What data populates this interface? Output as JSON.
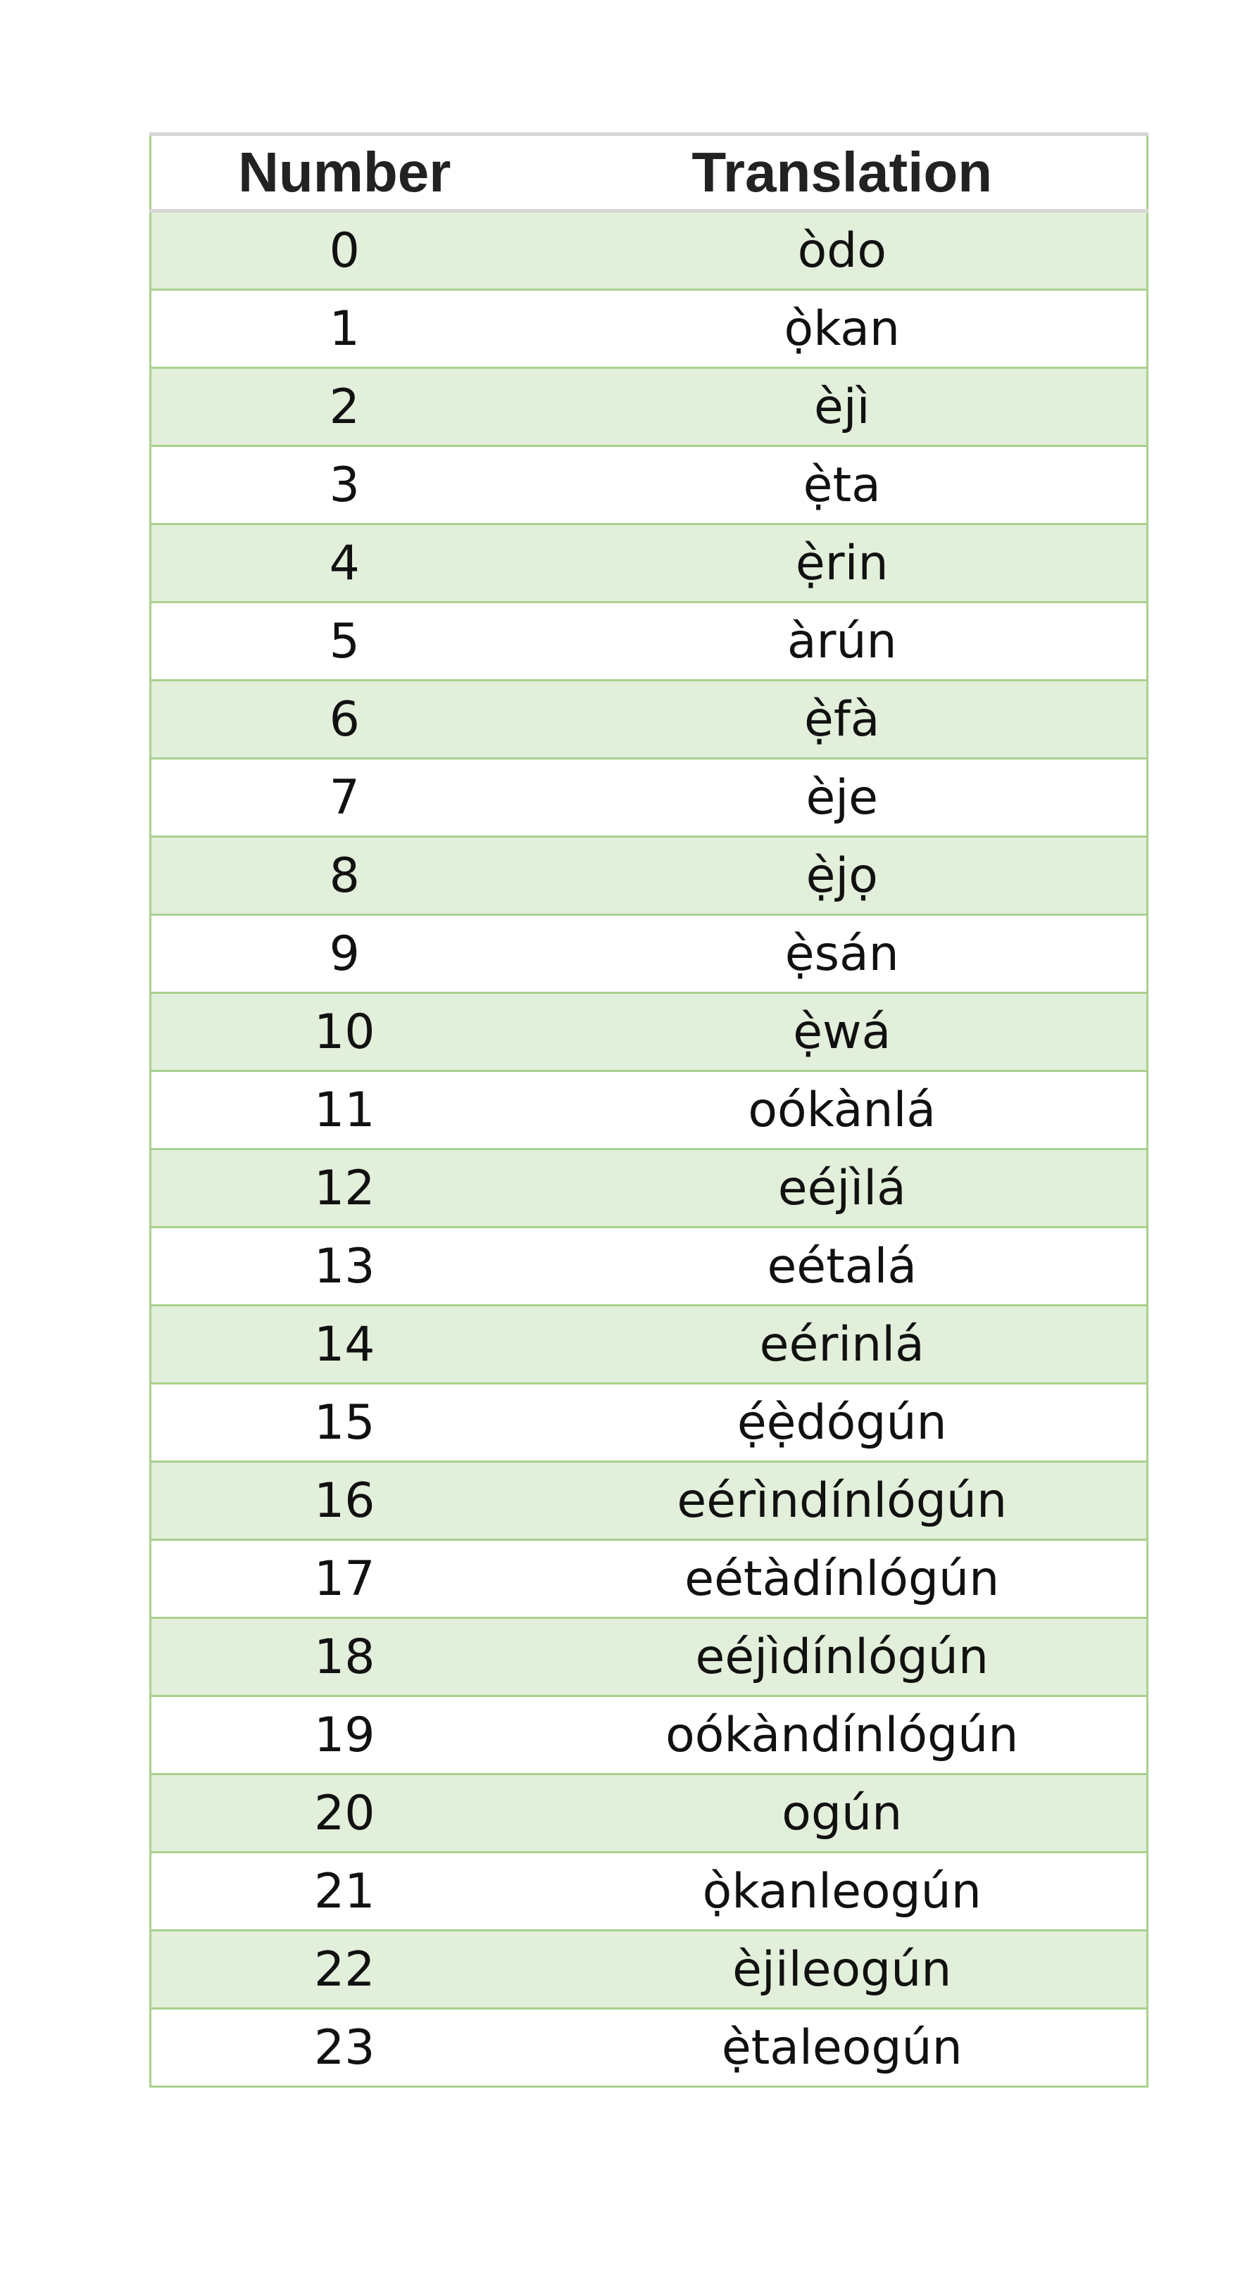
{
  "table": {
    "headers": {
      "number": "Number",
      "translation": "Translation"
    },
    "rows": [
      {
        "number": "0",
        "translation": "òdo"
      },
      {
        "number": "1",
        "translation": "ọ̀kan"
      },
      {
        "number": "2",
        "translation": "èjì"
      },
      {
        "number": "3",
        "translation": "ẹ̀ta"
      },
      {
        "number": "4",
        "translation": "ẹ̀rin"
      },
      {
        "number": "5",
        "translation": "àrún"
      },
      {
        "number": "6",
        "translation": "ẹ̀fà"
      },
      {
        "number": "7",
        "translation": "èje"
      },
      {
        "number": "8",
        "translation": "ẹ̀jọ"
      },
      {
        "number": "9",
        "translation": "ẹ̀sán"
      },
      {
        "number": "10",
        "translation": "ẹ̀wá"
      },
      {
        "number": "11",
        "translation": "oókànlá"
      },
      {
        "number": "12",
        "translation": "eéjìlá"
      },
      {
        "number": "13",
        "translation": "eétalá"
      },
      {
        "number": "14",
        "translation": "eérinlá"
      },
      {
        "number": "15",
        "translation": "ẹ́ẹ̀dógún"
      },
      {
        "number": "16",
        "translation": "eérìndínlógún"
      },
      {
        "number": "17",
        "translation": "eétàdínlógún"
      },
      {
        "number": "18",
        "translation": "eéjìdínlógún"
      },
      {
        "number": "19",
        "translation": "oókàndínlógún"
      },
      {
        "number": "20",
        "translation": "ogún"
      },
      {
        "number": "21",
        "translation": "ọ̀kanleogún"
      },
      {
        "number": "22",
        "translation": "èjileogún"
      },
      {
        "number": "23",
        "translation": "ẹ̀taleogún"
      }
    ]
  },
  "colors": {
    "row_band": "#e2efda",
    "grid_line": "#a9d18e",
    "header_rule": "#d6d6d6"
  }
}
